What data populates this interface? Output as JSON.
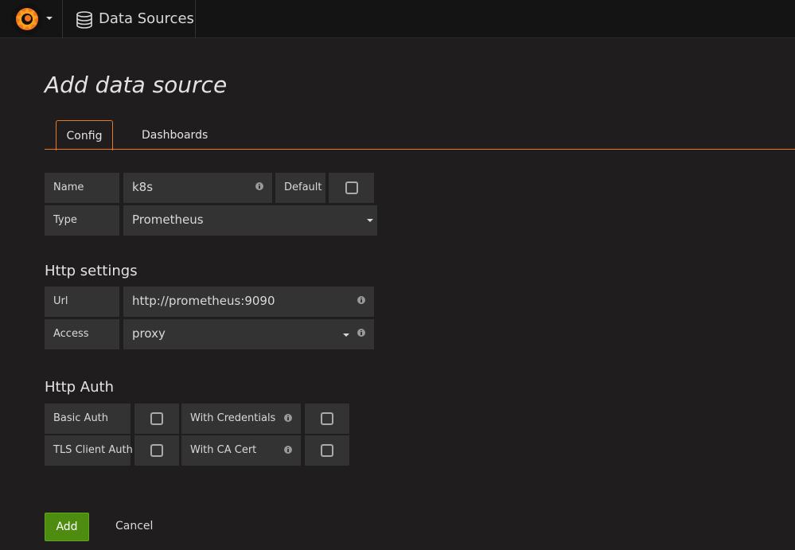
{
  "navbar": {
    "breadcrumb_label": "Data Sources"
  },
  "page": {
    "title": "Add data source"
  },
  "tabs": [
    {
      "label": "Config",
      "active": true
    },
    {
      "label": "Dashboards",
      "active": false
    }
  ],
  "general": {
    "name_label": "Name",
    "name_value": "k8s",
    "default_label": "Default",
    "default_checked": false,
    "type_label": "Type",
    "type_value": "Prometheus"
  },
  "http_settings": {
    "title": "Http settings",
    "url_label": "Url",
    "url_value": "http://prometheus:9090",
    "access_label": "Access",
    "access_value": "proxy"
  },
  "http_auth": {
    "title": "Http Auth",
    "basic_auth_label": "Basic Auth",
    "basic_auth_checked": false,
    "with_credentials_label": "With Credentials",
    "with_credentials_checked": false,
    "tls_client_auth_label": "TLS Client Auth",
    "tls_client_auth_checked": false,
    "with_ca_cert_label": "With CA Cert",
    "with_ca_cert_checked": false
  },
  "actions": {
    "add_label": "Add",
    "cancel_label": "Cancel"
  },
  "colors": {
    "accent": "#eb7b18",
    "add_button": "#4e8c11",
    "background": "#1f1d1d",
    "field": "#333333"
  }
}
